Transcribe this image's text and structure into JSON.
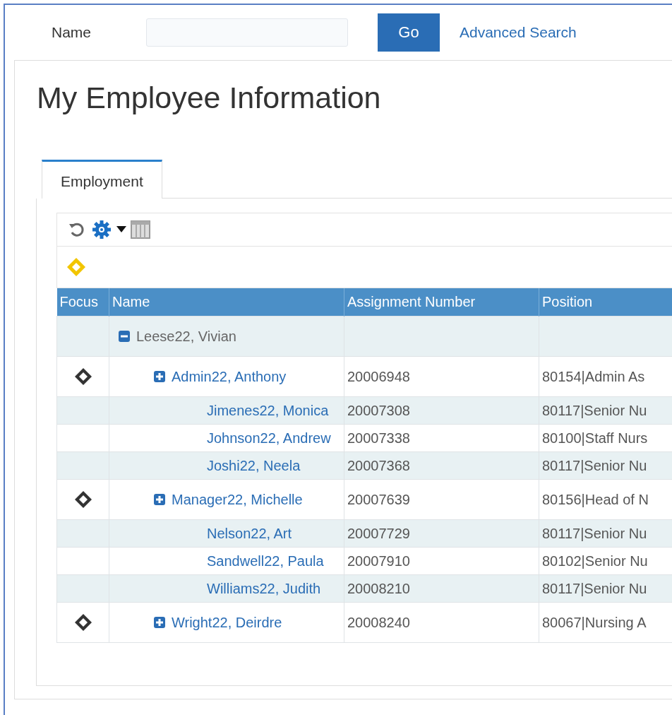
{
  "search": {
    "label": "Name",
    "button": "Go",
    "link": "Advanced Search"
  },
  "title": "My Employee Information",
  "tabs": [
    {
      "label": "Employment",
      "selected": true
    }
  ],
  "table": {
    "columns": [
      "Focus",
      "Name",
      "Assignment Number",
      "Position"
    ],
    "rows": [
      {
        "name": "Leese22, Vivian",
        "focus": false,
        "expanded": true,
        "assignment": "",
        "position": "",
        "children": [
          {
            "name": "Admin22, Anthony",
            "focus": true,
            "expanded": false,
            "assignment": "20006948",
            "position": "80154|Admin As",
            "children": [
              {
                "name": "Jimenes22, Monica",
                "focus": false,
                "assignment": "20007308",
                "position": "80117|Senior Nu"
              },
              {
                "name": "Johnson22, Andrew",
                "focus": false,
                "assignment": "20007338",
                "position": "80100|Staff Nurs"
              },
              {
                "name": "Joshi22, Neela",
                "focus": false,
                "assignment": "20007368",
                "position": "80117|Senior Nu"
              }
            ]
          },
          {
            "name": "Manager22, Michelle",
            "focus": true,
            "expanded": false,
            "assignment": "20007639",
            "position": "80156|Head of N",
            "children": [
              {
                "name": "Nelson22, Art",
                "focus": false,
                "assignment": "20007729",
                "position": "80117|Senior Nu"
              },
              {
                "name": "Sandwell22, Paula",
                "focus": false,
                "assignment": "20007910",
                "position": "80102|Senior Nu"
              },
              {
                "name": "Williams22, Judith",
                "focus": false,
                "assignment": "20008210",
                "position": "80117|Senior Nu"
              }
            ]
          },
          {
            "name": "Wright22, Deirdre",
            "focus": true,
            "expanded": false,
            "assignment": "20008240",
            "position": "80067|Nursing A"
          }
        ]
      }
    ]
  }
}
